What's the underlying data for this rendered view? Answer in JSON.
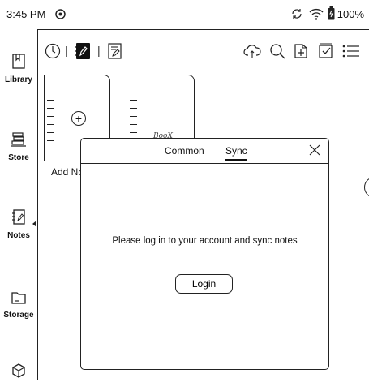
{
  "status_bar": {
    "time": "3:45 PM",
    "battery": "100%",
    "icons": [
      "sync-status-icon",
      "sync-icon",
      "wifi-icon",
      "battery-icon"
    ]
  },
  "sidebar": {
    "items": [
      {
        "label": "Library",
        "icon": "library-icon"
      },
      {
        "label": "Store",
        "icon": "store-icon"
      },
      {
        "label": "Notes",
        "icon": "notes-icon",
        "active": true
      },
      {
        "label": "Storage",
        "icon": "storage-icon"
      },
      {
        "label": "",
        "icon": "apps-icon"
      }
    ]
  },
  "toolbar": {
    "left_icons": [
      "recent-icon",
      "notebook-icon",
      "note-list-icon"
    ],
    "right_icons": [
      "cloud-sync-icon",
      "search-icon",
      "new-folder-icon",
      "multi-select-icon",
      "view-options-icon"
    ]
  },
  "notebooks": {
    "add_label": "Add No",
    "sample_cover_text": "BooX"
  },
  "dialog": {
    "tabs": [
      {
        "label": "Common",
        "selected": false
      },
      {
        "label": "Sync",
        "selected": true
      }
    ],
    "message": "Please log in to your account and sync notes",
    "login_button": "Login"
  }
}
